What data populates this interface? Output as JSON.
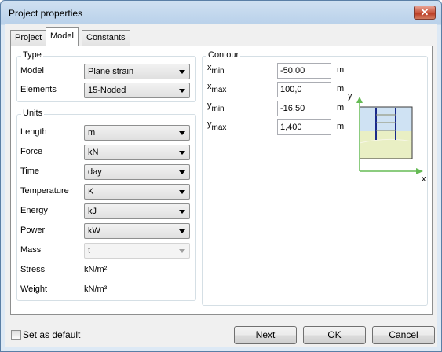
{
  "window": {
    "title": "Project properties",
    "close_glyph": "✕"
  },
  "tabs": [
    {
      "label": "Project",
      "active": false
    },
    {
      "label": "Model",
      "active": true
    },
    {
      "label": "Constants",
      "active": false
    }
  ],
  "type_group": {
    "title": "Type",
    "model_label": "Model",
    "model_value": "Plane strain",
    "elements_label": "Elements",
    "elements_value": "15-Noded"
  },
  "units_group": {
    "title": "Units",
    "rows": [
      {
        "label": "Length",
        "value": "m"
      },
      {
        "label": "Force",
        "value": "kN"
      },
      {
        "label": "Time",
        "value": "day"
      },
      {
        "label": "Temperature",
        "value": "K"
      },
      {
        "label": "Energy",
        "value": "kJ"
      },
      {
        "label": "Power",
        "value": "kW"
      },
      {
        "label": "Mass",
        "value": "t"
      },
      {
        "label": "Stress",
        "value": "kN/m²"
      },
      {
        "label": "Weight",
        "value": "kN/m³"
      }
    ]
  },
  "contour_group": {
    "title": "Contour",
    "rows": [
      {
        "var": "x",
        "sub": "min",
        "value": "-50,00",
        "unit": "m"
      },
      {
        "var": "x",
        "sub": "max",
        "value": "100,0",
        "unit": "m"
      },
      {
        "var": "y",
        "sub": "min",
        "value": "-16,50",
        "unit": "m"
      },
      {
        "var": "y",
        "sub": "max",
        "value": "1,400",
        "unit": "m"
      }
    ],
    "diagram": {
      "y_axis_label": "y",
      "x_axis_label": "x",
      "axis_color": "#66bb55",
      "soil_color": "#e9efc4",
      "sky_color": "#cfe2f3",
      "structure_color": "#1a2a8a"
    }
  },
  "footer": {
    "set_default_label": "Set as default",
    "set_default_checked": false,
    "next_label": "Next",
    "ok_label": "OK",
    "cancel_label": "Cancel"
  }
}
